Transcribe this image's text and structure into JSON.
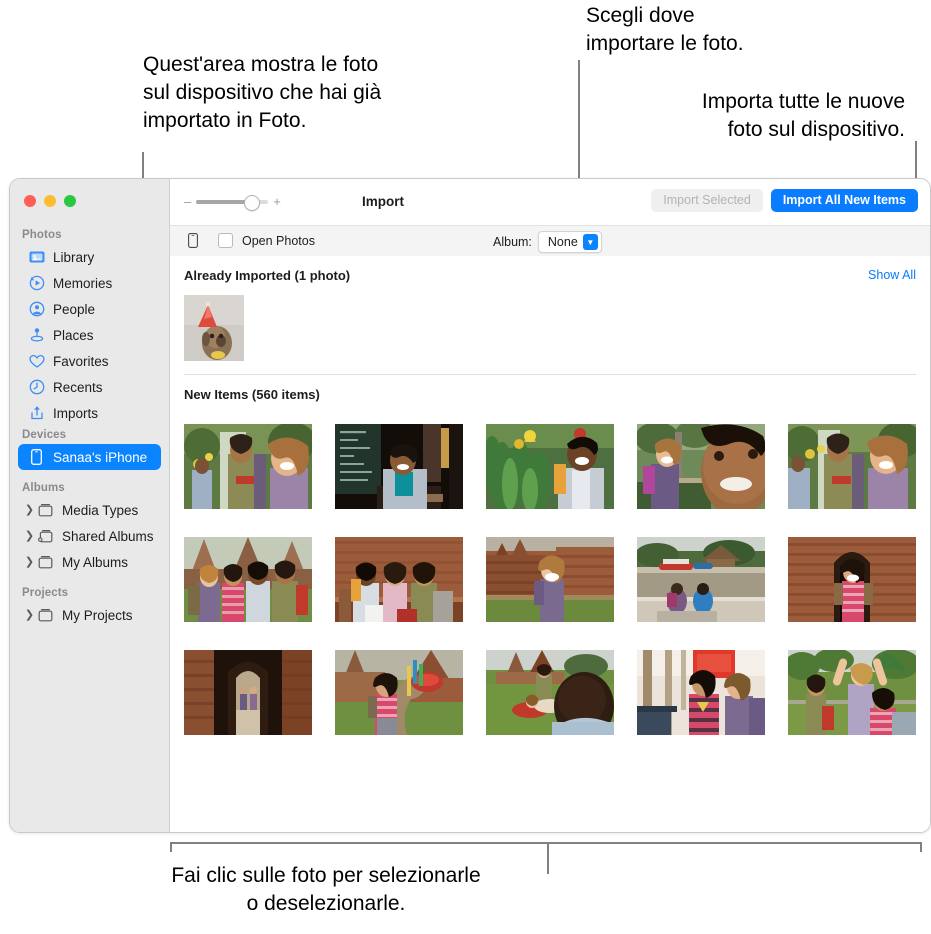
{
  "annotations": {
    "left": "Quest'area mostra le foto\nsul dispositivo che hai già\nimportato in Foto.",
    "top": "Scegli dove\nimportare le foto.",
    "right": "Importa tutte le nuove\nfoto sul dispositivo.",
    "bottom": "Fai clic sulle foto per selezionarle\no deselezionarle."
  },
  "colors": {
    "accent": "#0a7cff",
    "selection": "#0a84ff",
    "sidebar_bg": "#e9e9e9",
    "link": "#0a7cff"
  },
  "window": {
    "traffic_lights": [
      "close-button",
      "minimize-button",
      "maximize-button"
    ]
  },
  "sidebar": {
    "sections": [
      {
        "title": "Photos",
        "items": [
          {
            "label": "Library",
            "icon": "library-icon",
            "selected": false,
            "disclosure": false
          },
          {
            "label": "Memories",
            "icon": "memories-icon",
            "selected": false,
            "disclosure": false
          },
          {
            "label": "People",
            "icon": "people-icon",
            "selected": false,
            "disclosure": false
          },
          {
            "label": "Places",
            "icon": "places-icon",
            "selected": false,
            "disclosure": false
          },
          {
            "label": "Favorites",
            "icon": "heart-icon",
            "selected": false,
            "disclosure": false
          },
          {
            "label": "Recents",
            "icon": "clock-icon",
            "selected": false,
            "disclosure": false
          },
          {
            "label": "Imports",
            "icon": "import-icon",
            "selected": false,
            "disclosure": false
          }
        ]
      },
      {
        "title": "Devices",
        "items": [
          {
            "label": "Sanaa's iPhone",
            "icon": "iphone-icon",
            "selected": true,
            "disclosure": false
          }
        ]
      },
      {
        "title": "Albums",
        "items": [
          {
            "label": "Media Types",
            "icon": "album-icon",
            "selected": false,
            "disclosure": true
          },
          {
            "label": "Shared Albums",
            "icon": "shared-album-icon",
            "selected": false,
            "disclosure": true
          },
          {
            "label": "My Albums",
            "icon": "album-icon",
            "selected": false,
            "disclosure": true
          }
        ]
      },
      {
        "title": "Projects",
        "items": [
          {
            "label": "My Projects",
            "icon": "album-icon",
            "selected": false,
            "disclosure": true
          }
        ]
      }
    ]
  },
  "toolbar": {
    "title": "Import",
    "zoom_minus": "–",
    "zoom_plus": "+",
    "import_selected_label": "Import Selected",
    "import_all_label": "Import All New Items"
  },
  "subbar": {
    "device_icon": "iphone-icon",
    "open_photos_label": "Open Photos",
    "open_photos_checked": false,
    "album_label": "Album:",
    "album_value": "None",
    "album_options": [
      "None"
    ]
  },
  "content": {
    "already_imported_heading": "Already Imported (1 photo)",
    "show_all_label": "Show All",
    "new_items_heading": "New Items (560 items)",
    "already_imported_thumbs": [
      {
        "name": "dog-with-party-hat"
      }
    ],
    "new_items_thumbs": [
      {
        "name": "two-hikers-on-path"
      },
      {
        "name": "man-at-cafe-chalkboard"
      },
      {
        "name": "man-with-yellow-flowers"
      },
      {
        "name": "woman-hiker-closeup"
      },
      {
        "name": "three-friends-walking"
      },
      {
        "name": "group-at-temple-ruins"
      },
      {
        "name": "three-friends-on-brick-steps"
      },
      {
        "name": "woman-at-red-brick-temple"
      },
      {
        "name": "two-people-by-river"
      },
      {
        "name": "woman-in-temple-archway"
      },
      {
        "name": "hikers-in-dark-corridor"
      },
      {
        "name": "woman-by-decorated-tree"
      },
      {
        "name": "friends-on-lawn"
      },
      {
        "name": "two-women-in-tuk-tuk"
      },
      {
        "name": "friends-arms-raised"
      }
    ]
  }
}
